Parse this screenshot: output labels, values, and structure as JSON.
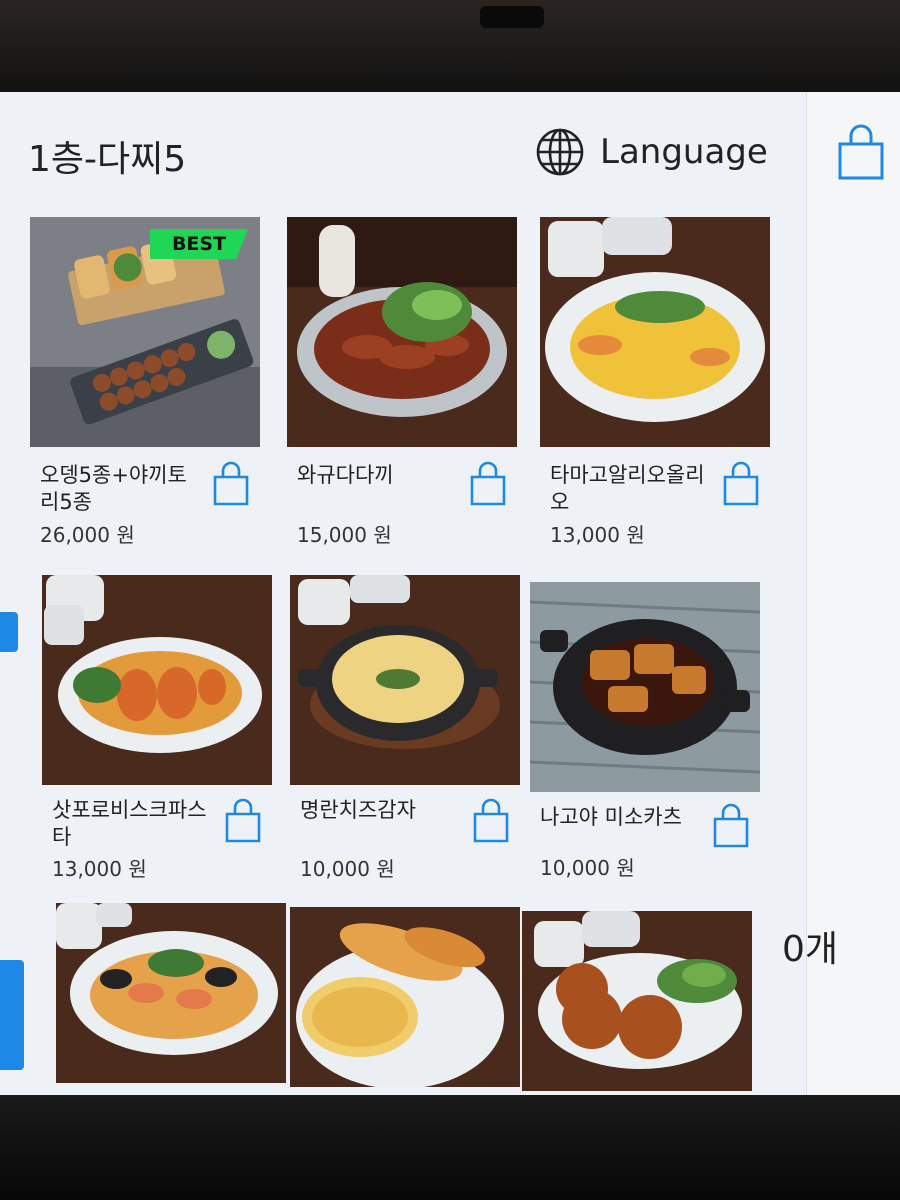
{
  "header": {
    "store_title": "1층-다찌5",
    "language_label": "Language",
    "globe_icon": "globe-icon"
  },
  "cart": {
    "icon": "shopping-bag-icon",
    "count_label": "0개"
  },
  "colors": {
    "accent": "#1e88e5",
    "best_badge": "#1fd655",
    "screen_bg": "#eef2f6"
  },
  "menu": {
    "items": [
      {
        "name": "오뎅5종+야끼토리5종",
        "price": "26,000 원",
        "badge": "BEST"
      },
      {
        "name": "와규다다끼",
        "price": "15,000 원"
      },
      {
        "name": "타마고알리오올리오",
        "price": "13,000 원"
      },
      {
        "name": "삿포로비스크파스타",
        "price": "13,000 원"
      },
      {
        "name": "명란치즈감자",
        "price": "10,000 원"
      },
      {
        "name": "나고야 미소카츠",
        "price": "10,000 원"
      },
      {
        "name": ""
      },
      {
        "name": ""
      },
      {
        "name": ""
      }
    ]
  }
}
